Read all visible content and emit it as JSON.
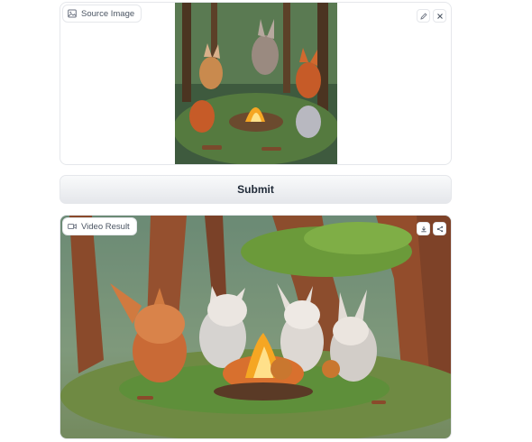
{
  "source": {
    "label": "Source Image",
    "icons": {
      "label": "image-icon",
      "edit": "pencil-icon",
      "clear": "close-icon"
    }
  },
  "submit": {
    "label": "Submit"
  },
  "video": {
    "label": "Video Result",
    "icons": {
      "label": "video-camera-icon",
      "download": "download-icon",
      "share": "share-icon"
    }
  },
  "colors": {
    "border": "#e5e7eb",
    "button_top": "#f9fafb",
    "button_bottom": "#e5e7eb",
    "forest": "#2f4d37",
    "fire": "#f5a623",
    "fox": "#c65b28"
  }
}
